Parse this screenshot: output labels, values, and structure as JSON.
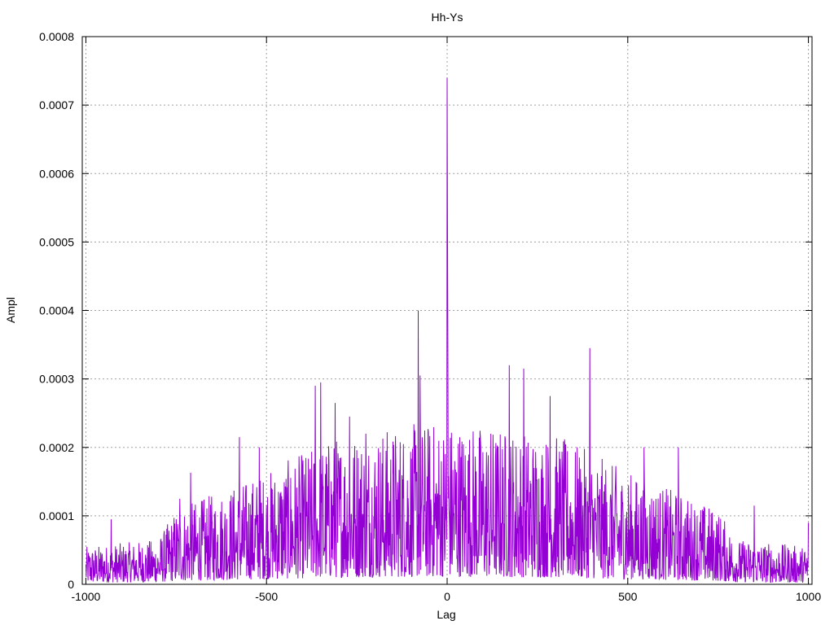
{
  "chart_data": {
    "type": "line",
    "title": "Hh-Ys",
    "xlabel": "Lag",
    "ylabel": "Ampl",
    "xlim": [
      -1010,
      1010
    ],
    "ylim": [
      0,
      0.0008
    ],
    "grid": true,
    "color": "#9400d3",
    "x_ticks": [
      -1000,
      -500,
      0,
      500,
      1000
    ],
    "x_tick_labels": [
      "-1000",
      "-500",
      "0",
      "500",
      "1000"
    ],
    "y_ticks": [
      0,
      0.0001,
      0.0002,
      0.0003,
      0.0004,
      0.0005,
      0.0006,
      0.0007,
      0.0008
    ],
    "y_tick_labels": [
      "0",
      "0.0001",
      "0.0002",
      "0.0003",
      "0.0004",
      "0.0005",
      "0.0006",
      "0.0007",
      "0.0008"
    ],
    "series": [
      {
        "peaks": [
          {
            "x": 0,
            "y": 0.00074
          },
          {
            "x": 1,
            "y": 0.00053
          },
          {
            "x": 2,
            "y": 0.000355
          },
          {
            "x": -80,
            "y": 0.0004
          },
          {
            "x": -75,
            "y": 0.000305
          },
          {
            "x": 395,
            "y": 0.000345
          },
          {
            "x": 172,
            "y": 0.00032
          },
          {
            "x": 212,
            "y": 0.000315
          },
          {
            "x": -350,
            "y": 0.000295
          },
          {
            "x": -365,
            "y": 0.00029
          },
          {
            "x": 285,
            "y": 0.000275
          },
          {
            "x": -310,
            "y": 0.000265
          },
          {
            "x": -270,
            "y": 0.000245
          },
          {
            "x": -225,
            "y": 0.00022
          },
          {
            "x": -575,
            "y": 0.000215
          },
          {
            "x": -520,
            "y": 0.0002
          },
          {
            "x": 640,
            "y": 0.0002
          },
          {
            "x": 545,
            "y": 0.0002
          },
          {
            "x": -710,
            "y": 0.000163
          },
          {
            "x": -740,
            "y": 0.000125
          },
          {
            "x": 850,
            "y": 0.000115
          },
          {
            "x": -930,
            "y": 9.5e-05
          },
          {
            "x": 1000,
            "y": 9e-05
          }
        ],
        "envelope": [
          {
            "x": -1000,
            "y": 5e-05
          },
          {
            "x": -800,
            "y": 6e-05
          },
          {
            "x": -750,
            "y": 0.0001
          },
          {
            "x": -500,
            "y": 0.00015
          },
          {
            "x": -300,
            "y": 0.0002
          },
          {
            "x": 0,
            "y": 0.00022
          },
          {
            "x": 300,
            "y": 0.0002
          },
          {
            "x": 500,
            "y": 0.00015
          },
          {
            "x": 750,
            "y": 0.0001
          },
          {
            "x": 800,
            "y": 6e-05
          },
          {
            "x": 1000,
            "y": 5e-05
          }
        ]
      }
    ]
  }
}
